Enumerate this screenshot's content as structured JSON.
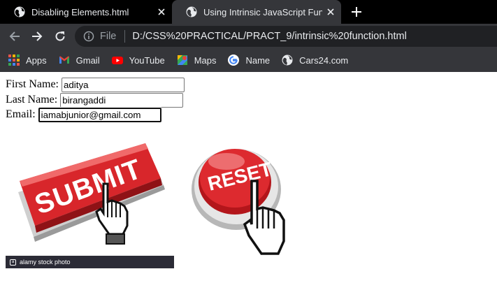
{
  "browser": {
    "tabs": [
      {
        "title": "Disabling Elements.html",
        "active": false
      },
      {
        "title": "Using Intrinsic JavaScript Function",
        "active": true
      }
    ],
    "omnibox": {
      "scheme_label": "File",
      "url": "D:/CSS%20PRACTICAL/PRACT_9/intrinsic%20function.html"
    },
    "bookmarks": [
      {
        "label": "Apps",
        "icon": "apps-grid-icon"
      },
      {
        "label": "Gmail",
        "icon": "gmail-icon"
      },
      {
        "label": "YouTube",
        "icon": "youtube-icon"
      },
      {
        "label": "Maps",
        "icon": "maps-icon"
      },
      {
        "label": "Name",
        "icon": "google-icon"
      },
      {
        "label": "Cars24.com",
        "icon": "globe-icon"
      }
    ]
  },
  "form": {
    "first_name": {
      "label": "First Name:",
      "value": "aditya"
    },
    "last_name": {
      "label": "Last Name:",
      "value": "birangaddi"
    },
    "email": {
      "label": "Email:",
      "value": "iamabjunior@gmail.com"
    }
  },
  "images": {
    "submit": {
      "text": "SUBMIT",
      "watermark": "alamy stock photo"
    },
    "reset": {
      "text": "RESET"
    }
  },
  "colors": {
    "tabbar": "#000000",
    "toolbar": "#35363a",
    "omnibox": "#202124",
    "button_red": "#d8262b"
  }
}
